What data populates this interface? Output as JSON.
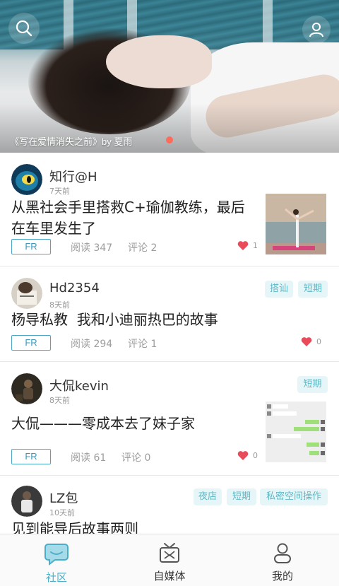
{
  "banner": {
    "caption": "《写在爱情消失之前》by 夏雨",
    "search_icon": "search-icon",
    "profile_icon": "user-icon"
  },
  "colors": {
    "accent": "#4aaec9",
    "tag_bg": "#e6f6f8",
    "tag_text": "#5cb8c6",
    "heart": "#e94b5a",
    "badge_border": "#4aa7c6"
  },
  "posts": [
    {
      "username": "知行@H",
      "time": "7天前",
      "title": "从黑社会手里搭救C+瑜伽教练，最后在车里发生了",
      "badge": "FR",
      "reads": "阅读 347",
      "comments": "评论 2",
      "likes": "1",
      "tags": []
    },
    {
      "username": "Hd2354",
      "time": "8天前",
      "title": "杨导私教  我和小迪丽热巴的故事",
      "badge": "FR",
      "reads": "阅读 294",
      "comments": "评论 1",
      "likes": "0",
      "tags": [
        "搭讪",
        "短期"
      ]
    },
    {
      "username": "大侃kevin",
      "time": "8天前",
      "title": "大侃———零成本去了妹子家",
      "badge": "FR",
      "reads": "阅读 61",
      "comments": "评论 0",
      "likes": "0",
      "tags": [
        "短期"
      ]
    },
    {
      "username": "LZ包",
      "time": "10天前",
      "title": "见到能导后故事两则",
      "tags": [
        "夜店",
        "短期",
        "私密空间操作"
      ]
    }
  ],
  "tabs": [
    {
      "label": "社区",
      "icon": "chat-bubble-icon",
      "active": true
    },
    {
      "label": "自媒体",
      "icon": "media-icon",
      "active": false
    },
    {
      "label": "我的",
      "icon": "user-icon",
      "active": false
    }
  ]
}
